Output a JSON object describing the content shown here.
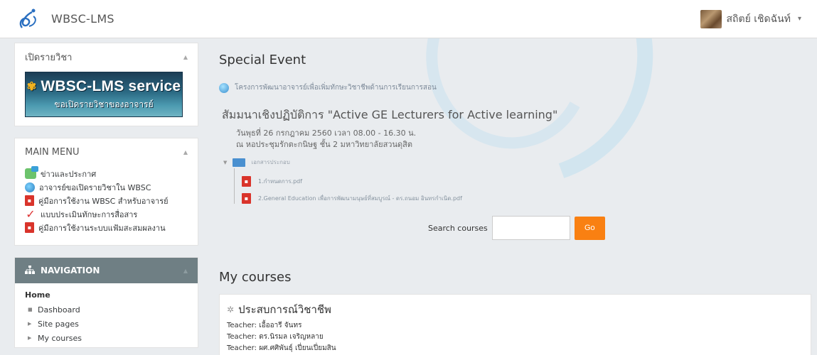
{
  "header": {
    "brand": "WBSC-LMS",
    "user_name": "สถิตย์ เชิดฉันท์",
    "caret": "▾"
  },
  "blocks": {
    "course_request": {
      "title": "เปิดรายวิชา",
      "banner_title": "WBSC-LMS service",
      "banner_subtitle": "ขอเปิดรายวิชาของอาจารย์"
    },
    "main_menu": {
      "title": "MAIN MENU",
      "items": [
        {
          "label": "ข่าวและประกาศ",
          "icon": "chat-icon"
        },
        {
          "label": "อาจารย์ขอเปิดรายวิชาใน WBSC",
          "icon": "globe-icon"
        },
        {
          "label": "คู่มือการใช้งาน WBSC สำหรับอาจารย์",
          "icon": "pdf-icon"
        },
        {
          "label": "แบบประเมินทักษะการสื่อสาร",
          "icon": "check-icon"
        },
        {
          "label": "คู่มือการใช้งานระบบแฟ้มสะสมผลงาน",
          "icon": "pdf-icon"
        }
      ]
    },
    "navigation": {
      "title": "NAVIGATION",
      "home": "Home",
      "items": [
        "Dashboard",
        "Site pages",
        "My courses"
      ]
    }
  },
  "main": {
    "special_event": {
      "title": "Special Event",
      "link": "โครงการพัฒนาอาจารย์เพื่อเพิ่มทักษะวิชาชีพด้านการเรียนการสอน",
      "headline": "สัมมนาเชิงปฏิบัติการ \"Active GE Lecturers for Active learning\"",
      "date": "วันพุธที่ 26 กรกฎาคม 2560 เวลา 08.00 - 16.30 น.",
      "place": "ณ หอประชุมรักตะกนิษฐ ชั้น 2 มหาวิทยาลัยสวนดุสิต",
      "folder": "เอกสารประกอบ",
      "files": [
        "1.กำหนดการ.pdf",
        "2.General Education เพื่อการพัฒนามนุษย์ที่สมบูรณ์ - ดร.ถนอม อินทรกำเนิด.pdf"
      ]
    },
    "search": {
      "label": "Search courses",
      "value": "",
      "button": "Go"
    },
    "my_courses": {
      "title": "My courses",
      "course_name": "ประสบการณ์วิชาชีพ",
      "teachers": [
        {
          "role": "Teacher",
          "name": "เอื้ออารี จันทร"
        },
        {
          "role": "Teacher",
          "name": "ดร.นิรมล เจริญหลาย"
        },
        {
          "role": "Teacher",
          "name": "ผศ.ศศิพันธุ์ เปี่ยนเปี่ยมสิน"
        }
      ]
    }
  },
  "colors": {
    "accent": "#f98012",
    "nav_header": "#6f7f84",
    "background": "#e9ecef"
  }
}
